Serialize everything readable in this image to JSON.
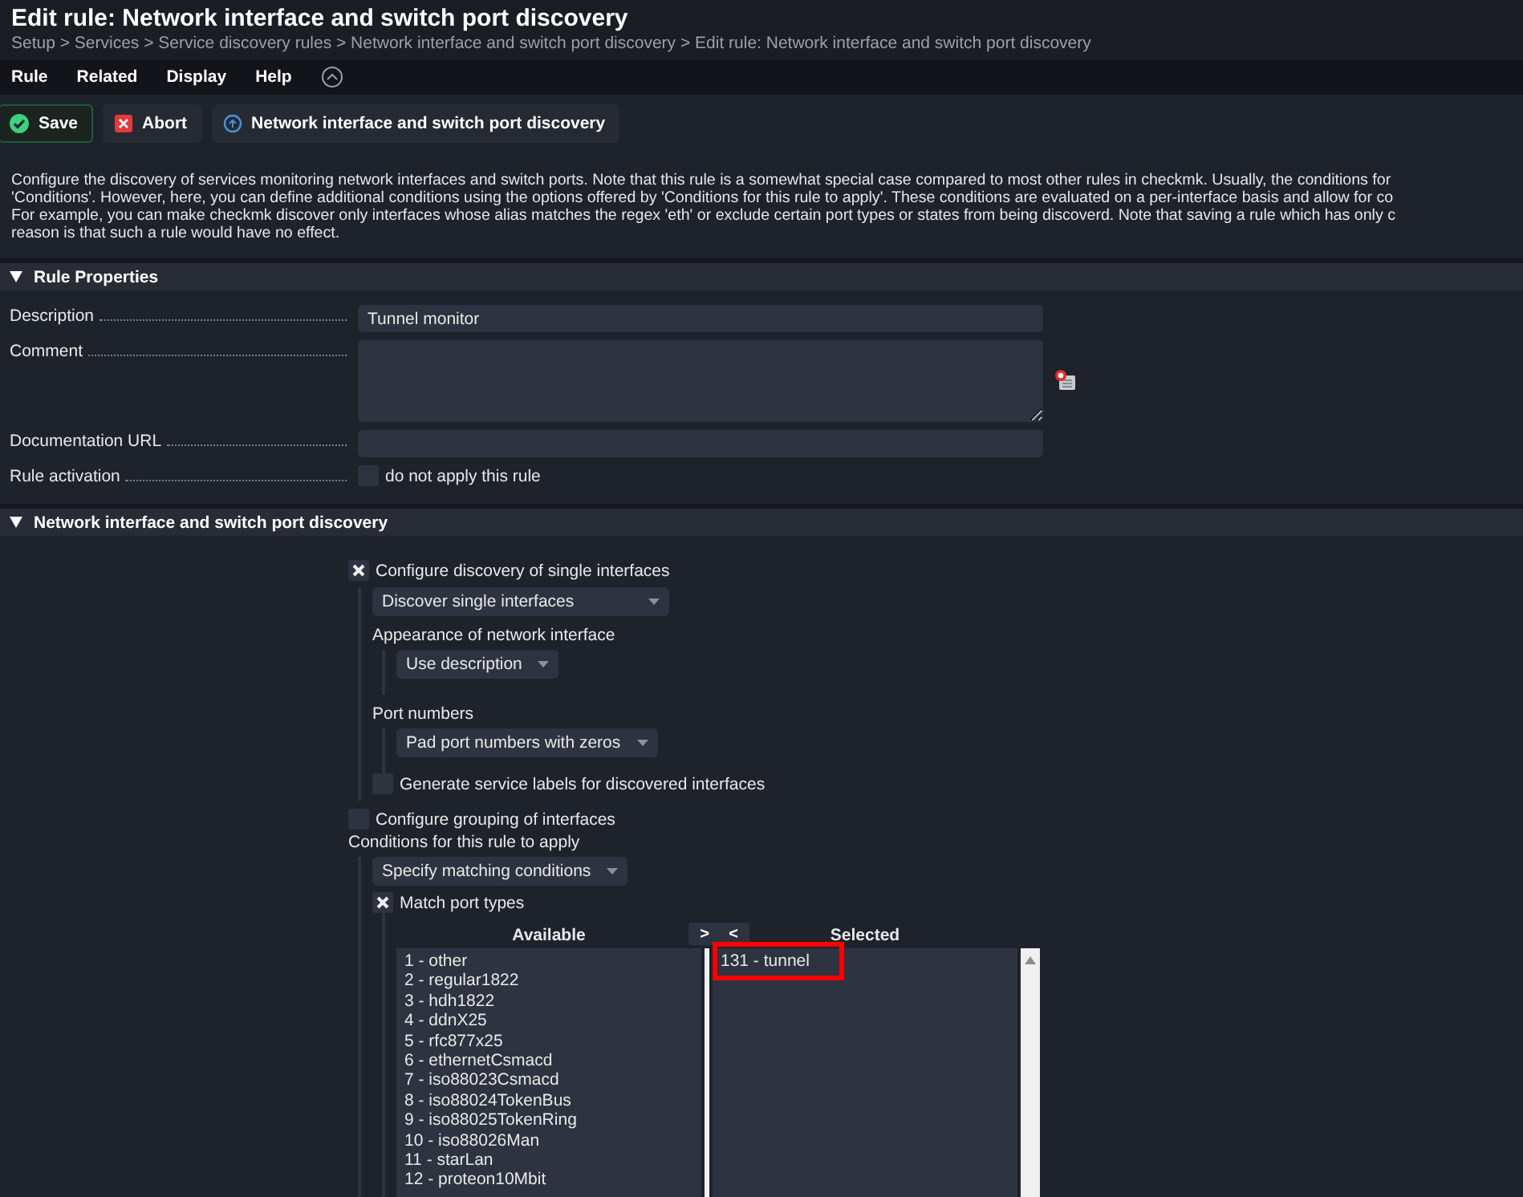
{
  "title": "Edit rule: Network interface and switch port discovery",
  "breadcrumb": "Setup > Services > Service discovery rules > Network interface and switch port discovery > Edit rule: Network interface and switch port discovery",
  "menu": [
    {
      "label": "Rule"
    },
    {
      "label": "Related"
    },
    {
      "label": "Display"
    },
    {
      "label": "Help"
    }
  ],
  "buttons": [
    {
      "kind": "save",
      "label": "Save"
    },
    {
      "kind": "abort",
      "label": "Abort"
    },
    {
      "kind": "link",
      "label": "Network interface and switch port discovery"
    }
  ],
  "help_lines": [
    "Configure the discovery of services monitoring network interfaces and switch ports. Note that this rule is a somewhat special case compared to most other rules in checkmk. Usually, the conditions for",
    "'Conditions'. However, here, you can define additional conditions using the options offered by 'Conditions for this rule to apply'. These conditions are evaluated on a per-interface basis and allow for co",
    "For example, you can make checkmk discover only interfaces whose alias matches the regex 'eth' or exclude certain port types or states from being discoverd. Note that saving a rule which has only c",
    "reason is that such a rule would have no effect."
  ],
  "rule_properties": {
    "title": "Rule Properties",
    "expanded": true,
    "rows": [
      {
        "kind": "text",
        "label": "Description",
        "value": "Tunnel monitor"
      },
      {
        "kind": "textarea",
        "label": "Comment"
      },
      {
        "kind": "text",
        "label": "Documentation URL"
      },
      {
        "kind": "checkbox",
        "label": "Rule activation",
        "option": "do not apply this rule",
        "checked": false
      }
    ]
  },
  "discovery": {
    "title": "Network interface and switch port discovery",
    "expanded": true,
    "single": {
      "label": "Configure discovery of single interfaces",
      "checked": true,
      "mode": "Discover single interfaces",
      "appearance_label": "Appearance of network interface",
      "appearance": "Use description",
      "port_label": "Port numbers",
      "port": "Pad port numbers with zeros",
      "labels": {
        "label": "Generate service labels for discovered interfaces",
        "checked": false
      }
    },
    "grouping": {
      "label": "Configure grouping of interfaces",
      "checked": false
    },
    "conditions_label": "Conditions for this rule to apply",
    "conditions": "Specify matching conditions",
    "match_port_types": {
      "label": "Match port types",
      "checked": true,
      "available_label": "Available",
      "selected_label": "Selected",
      "add": ">",
      "remove": "<",
      "available": [
        "1 - other",
        "2 - regular1822",
        "3 - hdh1822",
        "4 - ddnX25",
        "5 - rfc877x25",
        "6 - ethernetCsmacd",
        "7 - iso88023Csmacd",
        "8 - iso88024TokenBus",
        "9 - iso88025TokenRing",
        "10 - iso88026Man",
        "11 - starLan",
        "12 - proteon10Mbit"
      ],
      "selected": [
        {
          "label": "131 - tunnel",
          "highlighted": true
        }
      ]
    }
  }
}
